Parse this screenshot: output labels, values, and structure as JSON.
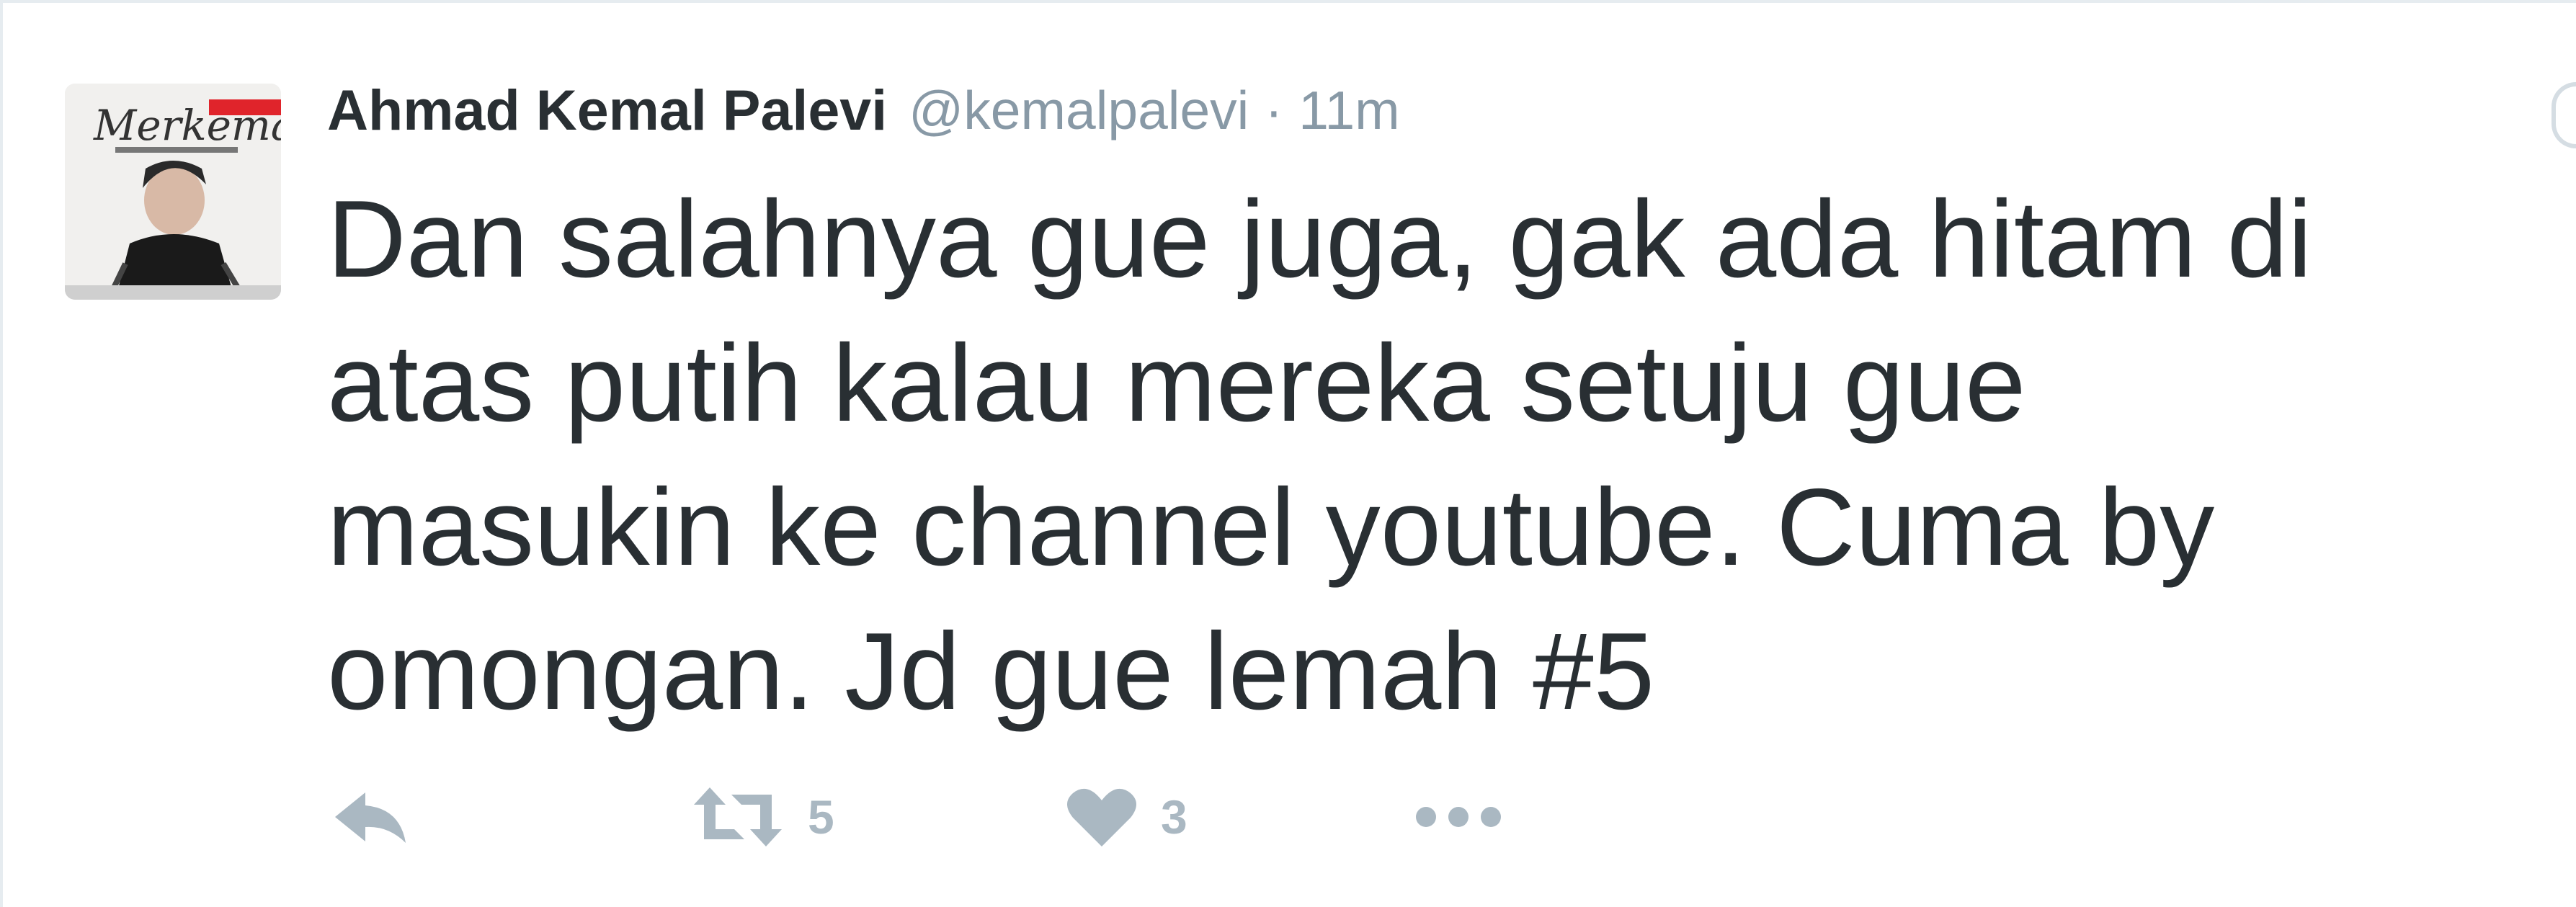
{
  "tweet": {
    "author": {
      "fullname": "Ahmad Kemal Palevi",
      "username": "@kemalpalevi",
      "avatar_text": "Merkemal"
    },
    "separator": "·",
    "timestamp": "11m",
    "text": "Dan salahnya gue juga, gak ada hitam di\natas putih kalau mereka setuju gue\nmasukin ke channel youtube. Cuma by\nomongan. Jd gue lemah #5",
    "actions": {
      "reply_icon": "reply-icon",
      "retweet_icon": "retweet-icon",
      "retweet_count": "5",
      "like_icon": "heart-icon",
      "like_count": "3",
      "more_icon": "more-dots-icon"
    }
  },
  "colors": {
    "text": "#292f33",
    "muted": "#8899a6",
    "icon": "#aab8c2",
    "border": "#e6ecf0"
  }
}
